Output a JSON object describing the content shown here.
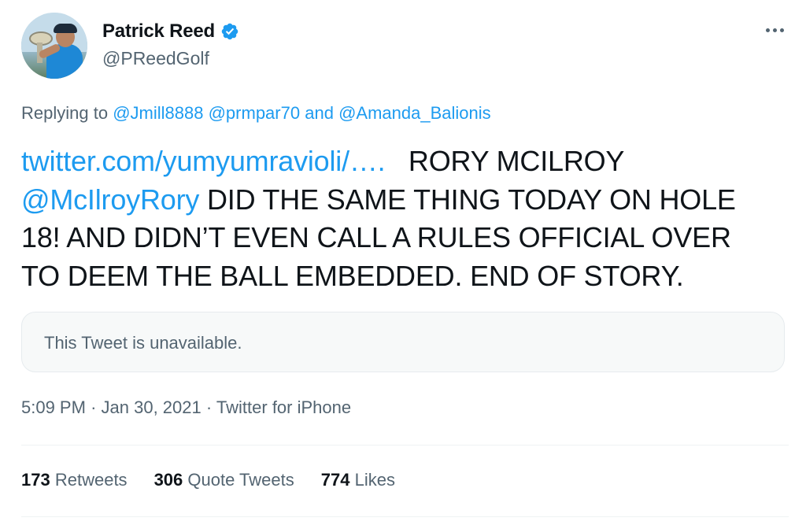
{
  "author": {
    "name": "Patrick Reed",
    "handle": "@PReedGolf",
    "verified": true,
    "avatar_icon": "profile-photo-golfer-with-trophy"
  },
  "reply": {
    "prefix": "Replying to",
    "mention1": "@Jmill8888",
    "mention2": "@prmpar70",
    "joiner": "and",
    "mention3": "@Amanda_Balionis"
  },
  "tweet": {
    "link": "twitter.com/yumyumravioli/….",
    "line1_rest": "RORY MCILROY",
    "mention": "@McIlroyRory",
    "line2_rest": "DID THE SAME THING TODAY ON HOLE",
    "line3": "18! AND DIDN’T EVEN CALL A RULES OFFICIAL OVER",
    "line4": "TO DEEM THE BALL EMBEDDED. END OF STORY."
  },
  "quote": {
    "text": "This Tweet is unavailable."
  },
  "meta": {
    "time": "5:09 PM",
    "separator": "·",
    "date": "Jan 30, 2021",
    "source": "Twitter for iPhone"
  },
  "stats": {
    "retweets_count": "173",
    "retweets_label": "Retweets",
    "quotes_count": "306",
    "quotes_label": "Quote Tweets",
    "likes_count": "774",
    "likes_label": "Likes"
  },
  "colors": {
    "link": "#1d9bf0",
    "text": "#0f1419",
    "secondary": "#536471",
    "verified_badge": "#1d9bf0"
  }
}
